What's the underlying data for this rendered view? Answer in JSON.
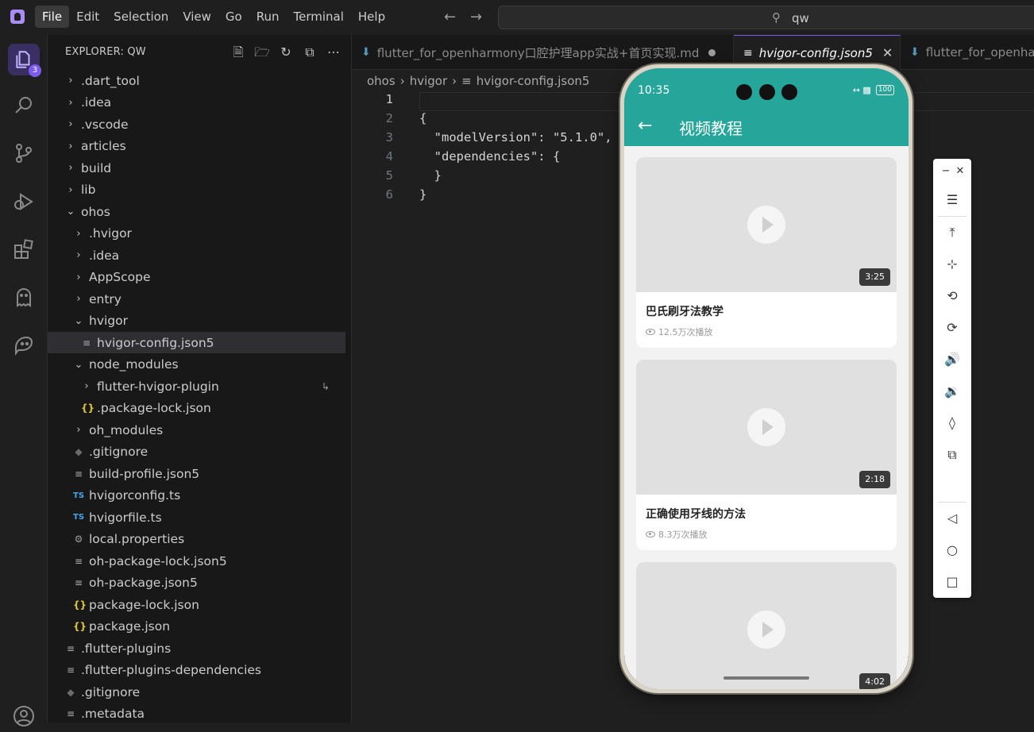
{
  "menu": [
    "File",
    "Edit",
    "Selection",
    "View",
    "Go",
    "Run",
    "Terminal",
    "Help"
  ],
  "search": {
    "text": "qw"
  },
  "activity": {
    "badge": "3"
  },
  "explorer": {
    "title": "EXPLORER: QW",
    "items": [
      {
        "label": ".dart_tool",
        "kind": "folder",
        "depth": 0,
        "open": false
      },
      {
        "label": ".idea",
        "kind": "folder",
        "depth": 0,
        "open": false
      },
      {
        "label": ".vscode",
        "kind": "folder",
        "depth": 0,
        "open": false
      },
      {
        "label": "articles",
        "kind": "folder",
        "depth": 0,
        "open": false
      },
      {
        "label": "build",
        "kind": "folder",
        "depth": 0,
        "open": false
      },
      {
        "label": "lib",
        "kind": "folder",
        "depth": 0,
        "open": false
      },
      {
        "label": "ohos",
        "kind": "folder",
        "depth": 0,
        "open": true
      },
      {
        "label": ".hvigor",
        "kind": "folder",
        "depth": 1,
        "open": false
      },
      {
        "label": ".idea",
        "kind": "folder",
        "depth": 1,
        "open": false
      },
      {
        "label": "AppScope",
        "kind": "folder",
        "depth": 1,
        "open": false
      },
      {
        "label": "entry",
        "kind": "folder",
        "depth": 1,
        "open": false
      },
      {
        "label": "hvigor",
        "kind": "folder",
        "depth": 1,
        "open": true
      },
      {
        "label": "hvigor-config.json5",
        "kind": "lines",
        "depth": 2,
        "selected": true
      },
      {
        "label": "node_modules",
        "kind": "folder",
        "depth": 1,
        "open": true
      },
      {
        "label": "flutter-hvigor-plugin",
        "kind": "folder",
        "depth": 2,
        "open": false,
        "link": true
      },
      {
        "label": ".package-lock.json",
        "kind": "json",
        "depth": 2
      },
      {
        "label": "oh_modules",
        "kind": "folder",
        "depth": 1,
        "open": false
      },
      {
        "label": ".gitignore",
        "kind": "git",
        "depth": 1
      },
      {
        "label": "build-profile.json5",
        "kind": "lines",
        "depth": 1
      },
      {
        "label": "hvigorconfig.ts",
        "kind": "ts",
        "depth": 1
      },
      {
        "label": "hvigorfile.ts",
        "kind": "ts",
        "depth": 1
      },
      {
        "label": "local.properties",
        "kind": "gear",
        "depth": 1
      },
      {
        "label": "oh-package-lock.json5",
        "kind": "lines",
        "depth": 1
      },
      {
        "label": "oh-package.json5",
        "kind": "lines",
        "depth": 1
      },
      {
        "label": "package-lock.json",
        "kind": "json",
        "depth": 1
      },
      {
        "label": "package.json",
        "kind": "json",
        "depth": 1
      },
      {
        "label": ".flutter-plugins",
        "kind": "lines",
        "depth": 0
      },
      {
        "label": ".flutter-plugins-dependencies",
        "kind": "lines",
        "depth": 0
      },
      {
        "label": ".gitignore",
        "kind": "git",
        "depth": 0
      },
      {
        "label": ".metadata",
        "kind": "lines",
        "depth": 0
      }
    ]
  },
  "tabs": [
    {
      "label": "flutter_for_openharmony口腔护理app实战+首页实现.md",
      "modified": true
    },
    {
      "label": "hvigor-config.json5",
      "active": true
    },
    {
      "label": "flutter_for_openha"
    }
  ],
  "breadcrumb": [
    "ohos",
    "hvigor",
    "hvigor-config.json5"
  ],
  "code": [
    {
      "n": "1",
      "text": ""
    },
    {
      "n": "2",
      "text": "{"
    },
    {
      "n": "3",
      "text": "  \"modelVersion\": \"5.1.0\","
    },
    {
      "n": "4",
      "text": "  \"dependencies\": {"
    },
    {
      "n": "5",
      "text": "  }"
    },
    {
      "n": "6",
      "text": "}"
    }
  ],
  "phone": {
    "time": "10:35",
    "battery": "100",
    "title": "视频教程",
    "videos": [
      {
        "title": "巴氏刷牙法教学",
        "views": "12.5万次播放",
        "duration": "3:25"
      },
      {
        "title": "正确使用牙线的方法",
        "views": "8.3万次播放",
        "duration": "2:18"
      },
      {
        "title": "",
        "views": "",
        "duration": "4:02"
      }
    ]
  }
}
